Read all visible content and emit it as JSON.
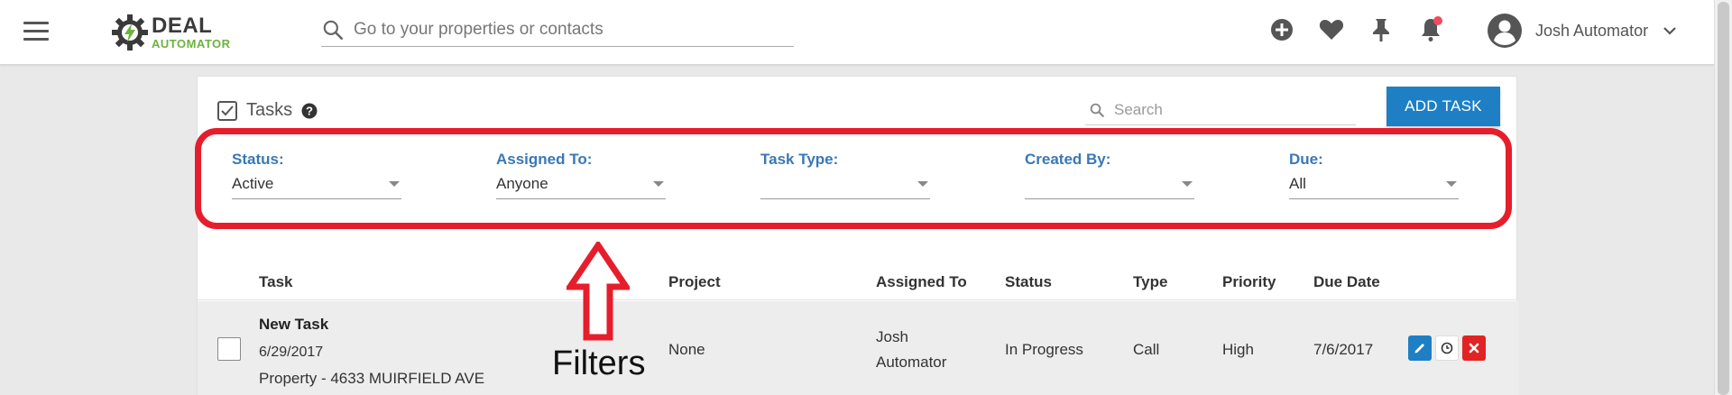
{
  "app": {
    "logo_line1": "DEAL",
    "logo_line2": "AUTOMATOR",
    "search_placeholder": "Go to your properties or contacts",
    "user_name": "Josh Automator",
    "colors": {
      "accent": "#1f7fc4",
      "logo_green": "#6cb33e",
      "annotation_red": "#e61e2b",
      "notification_dot": "#ef4b5f"
    }
  },
  "tasks_panel": {
    "title": "Tasks",
    "search_placeholder": "Search",
    "add_button": "ADD TASK",
    "filters": [
      {
        "label": "Status:",
        "value": "Active"
      },
      {
        "label": "Assigned To:",
        "value": "Anyone"
      },
      {
        "label": "Task Type:",
        "value": ""
      },
      {
        "label": "Created By:",
        "value": ""
      },
      {
        "label": "Due:",
        "value": "All"
      }
    ],
    "columns": [
      "Task",
      "Project",
      "Assigned To",
      "Status",
      "Type",
      "Priority",
      "Due Date"
    ],
    "rows": [
      {
        "name": "New Task",
        "date": "6/29/2017",
        "property": "Property - 4633 MUIRFIELD AVE",
        "project": "None",
        "assigned_line1": "Josh",
        "assigned_line2": "Automator",
        "status": "In Progress",
        "type": "Call",
        "priority": "High",
        "due_date": "7/6/2017"
      }
    ]
  },
  "annotation": {
    "label": "Filters"
  }
}
